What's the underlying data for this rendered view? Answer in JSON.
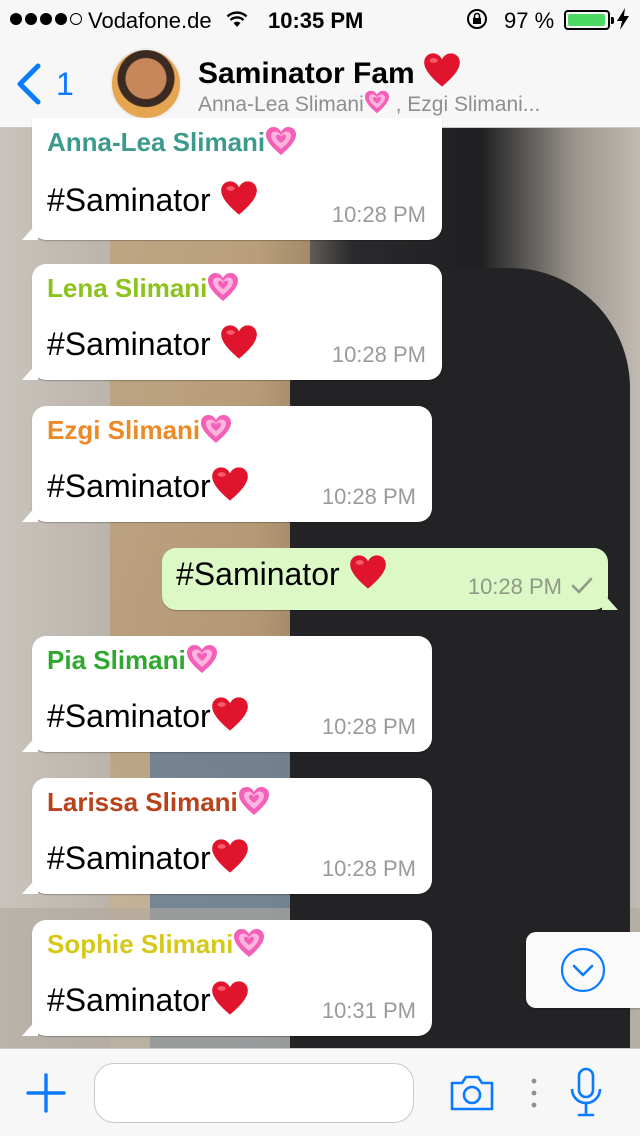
{
  "status_bar": {
    "carrier": "Vodafone.de",
    "time": "10:35 PM",
    "battery_percent": "97 %",
    "battery_level": 0.97,
    "signal_bars_filled": 4,
    "signal_bars_total": 5
  },
  "header": {
    "back_count": "1",
    "chat_title": "Saminator Fam",
    "participants_prefix": "Anna-Lea Slimani",
    "participants_suffix": " , Ezgi Slimani..."
  },
  "messages": [
    {
      "sender": "Anna-Lea Slimani",
      "text": "#Saminator",
      "time": "10:28 PM",
      "sender_color": "#3c9a8c"
    },
    {
      "sender": "Lena Slimani",
      "text": "#Saminator",
      "time": "10:28 PM",
      "sender_color": "#8cc21c"
    },
    {
      "sender": "Ezgi Slimani",
      "text": "#Saminator",
      "time": "10:28 PM",
      "sender_color": "#ec8a28"
    },
    {
      "sender": "",
      "text": "#Saminator",
      "time": "10:28 PM",
      "outgoing": true,
      "status": "sent"
    },
    {
      "sender": "Pia Slimani",
      "text": "#Saminator",
      "time": "10:28 PM",
      "sender_color": "#2fa82f"
    },
    {
      "sender": "Larissa Slimani",
      "text": "#Saminator",
      "time": "10:28 PM",
      "sender_color": "#b8421a"
    },
    {
      "sender": "Sophie Slimani",
      "text": "#Saminator",
      "time": "10:31 PM",
      "sender_color": "#d6c818"
    }
  ],
  "input": {
    "value": "",
    "placeholder": ""
  },
  "colors": {
    "accent": "#0a7aff",
    "outgoing_bubble": "#dcf8c6",
    "incoming_bubble": "#ffffff",
    "heart": "#e0142c",
    "pink_heart": "#f45fb8"
  },
  "icons": [
    "back-chevron-icon",
    "wifi-icon",
    "rotation-lock-icon",
    "battery-icon",
    "charging-bolt-icon",
    "red-heart-emoji",
    "sparkling-pink-heart-emoji",
    "double-check-icon",
    "chevron-down-circle-icon",
    "plus-icon",
    "camera-icon",
    "more-dots-icon",
    "microphone-icon"
  ]
}
